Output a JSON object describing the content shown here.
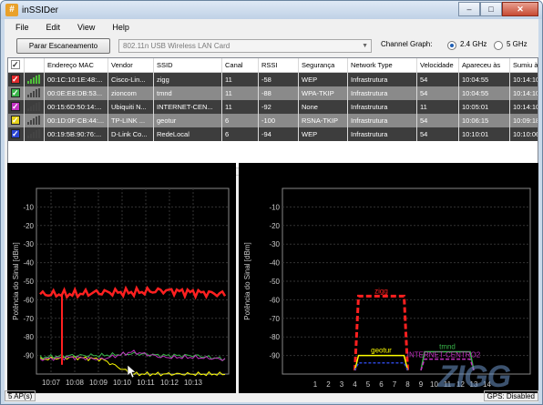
{
  "app": {
    "title": "inSSIDer",
    "icon": "app-hash-icon"
  },
  "window_buttons": {
    "minimize": "–",
    "maximize": "□",
    "close": "✕"
  },
  "menu": [
    "File",
    "Edit",
    "View",
    "Help"
  ],
  "toolbar": {
    "scan_button": "Parar Escaneamento",
    "adapter": "802.11n USB Wireless LAN Card",
    "channel_graph_label": "Channel Graph:",
    "band_24": "2.4 GHz",
    "band_5": "5 GHz",
    "selected_band": "2.4 GHz"
  },
  "table": {
    "columns": [
      "",
      "",
      "Endereço MAC",
      "Vendor",
      "SSID",
      "Canal",
      "RSSI",
      "Segurança",
      "Network Type",
      "Velocidade",
      "Apareceu às",
      "Sumiu às"
    ],
    "rows": [
      {
        "color": "#e0292b",
        "checked": "✓",
        "bars": "green",
        "mac": "00:1C:10:1E:48:...",
        "vendor": "Cisco-Lin...",
        "ssid": "zigg",
        "channel": "11",
        "rssi": "-58",
        "security": "WEP",
        "type": "Infrastrutura",
        "speed": "54",
        "first": "10:04:55",
        "last": "10:14:10",
        "style": "sel"
      },
      {
        "color": "#39b54a",
        "checked": "✓",
        "bars": "dark",
        "mac": "00:0E:E8:DB:53...",
        "vendor": "zioncom",
        "ssid": "tmnd",
        "channel": "11",
        "rssi": "-88",
        "security": "WPA-TKIP",
        "type": "Infrastrutura",
        "speed": "54",
        "first": "10:04:55",
        "last": "10:14:10",
        "style": "gray"
      },
      {
        "color": "#c232c2",
        "checked": "✓",
        "bars": "dark",
        "mac": "00:15:6D:50:14:...",
        "vendor": "Ubiquiti N...",
        "ssid": "INTERNET-CEN...",
        "channel": "11",
        "rssi": "-92",
        "security": "None",
        "type": "Infrastrutura",
        "speed": "11",
        "first": "10:05:01",
        "last": "10:14:10",
        "style": "sel"
      },
      {
        "color": "#e6d21a",
        "checked": "✓",
        "bars": "dark",
        "mac": "00:1D:0F:CB:44:...",
        "vendor": "TP-LINK ...",
        "ssid": "geotur",
        "channel": "6",
        "rssi": "-100",
        "security": "RSNA-TKIP",
        "type": "Infrastrutura",
        "speed": "54",
        "first": "10:06:15",
        "last": "10:09:18",
        "style": "gray"
      },
      {
        "color": "#2b45d6",
        "checked": "✓",
        "bars": "dark",
        "mac": "00:19:5B:90:76:...",
        "vendor": "D-Link Co...",
        "ssid": "RedeLocal",
        "channel": "6",
        "rssi": "-94",
        "security": "WEP",
        "type": "Infrastrutura",
        "speed": "54",
        "first": "10:10:01",
        "last": "10:10:06",
        "style": "sel"
      }
    ]
  },
  "time_chart": {
    "ylabel": "Potência do Sinal [dBm]",
    "yticks": [
      "-10",
      "-20",
      "-30",
      "-40",
      "-50",
      "-60",
      "-70",
      "-80",
      "-90"
    ],
    "xticks": [
      "10:07",
      "10:08",
      "10:09",
      "10:10",
      "10:11",
      "10:12",
      "10:13"
    ]
  },
  "channel_chart": {
    "ylabel": "Potência do Sinal [dBm]",
    "yticks": [
      "-10",
      "-20",
      "-30",
      "-40",
      "-50",
      "-60",
      "-70",
      "-80",
      "-90"
    ],
    "xticks": [
      "1",
      "2",
      "3",
      "4",
      "5",
      "6",
      "7",
      "8",
      "9",
      "10",
      "11",
      "12",
      "13",
      "14"
    ],
    "labels": [
      "zigg",
      "geotur",
      "tmnd",
      "INTERNET-CENTRO2"
    ]
  },
  "chart_data": [
    {
      "type": "line",
      "ylabel": "Potência do Sinal [dBm]",
      "ylim": [
        -100,
        0
      ],
      "x": [
        "10:07",
        "10:08",
        "10:09",
        "10:10",
        "10:11",
        "10:12",
        "10:13"
      ],
      "series": [
        {
          "name": "zigg",
          "color": "#ff2020",
          "values": [
            -57,
            -57,
            -56,
            -56,
            -55,
            -56,
            -57
          ]
        },
        {
          "name": "geotur",
          "color": "#ffff00",
          "values": [
            -92,
            -91,
            -92,
            -100,
            -100,
            -100,
            -100
          ]
        },
        {
          "name": "tmnd",
          "color": "#39b54a",
          "values": [
            -91,
            -90,
            -90,
            -89,
            -90,
            -90,
            -92
          ]
        },
        {
          "name": "INTERNET-CENTRO2",
          "color": "#c232c2",
          "values": [
            -92,
            -91,
            -92,
            -88,
            -91,
            -91,
            -92
          ]
        }
      ]
    },
    {
      "type": "line",
      "ylabel": "Potência do Sinal [dBm]",
      "ylim": [
        -100,
        0
      ],
      "x": [
        1,
        2,
        3,
        4,
        5,
        6,
        7,
        8,
        9,
        10,
        11,
        12,
        13,
        14
      ],
      "series": [
        {
          "name": "zigg",
          "channel": 6,
          "rssi": -58,
          "color": "#ff2020"
        },
        {
          "name": "geotur",
          "channel": 6,
          "rssi": -90,
          "color": "#ffff00"
        },
        {
          "name": "RedeLocal",
          "channel": 6,
          "rssi": -94,
          "color": "#2b45d6"
        },
        {
          "name": "tmnd",
          "channel": 11,
          "rssi": -88,
          "color": "#39b54a"
        },
        {
          "name": "INTERNET-CENTRO2",
          "channel": 11,
          "rssi": -92,
          "color": "#c232c2"
        }
      ]
    }
  ],
  "status": {
    "ap_count": "5 AP(s)",
    "gps": "GPS: Disabled"
  },
  "watermark": "ZIGG"
}
